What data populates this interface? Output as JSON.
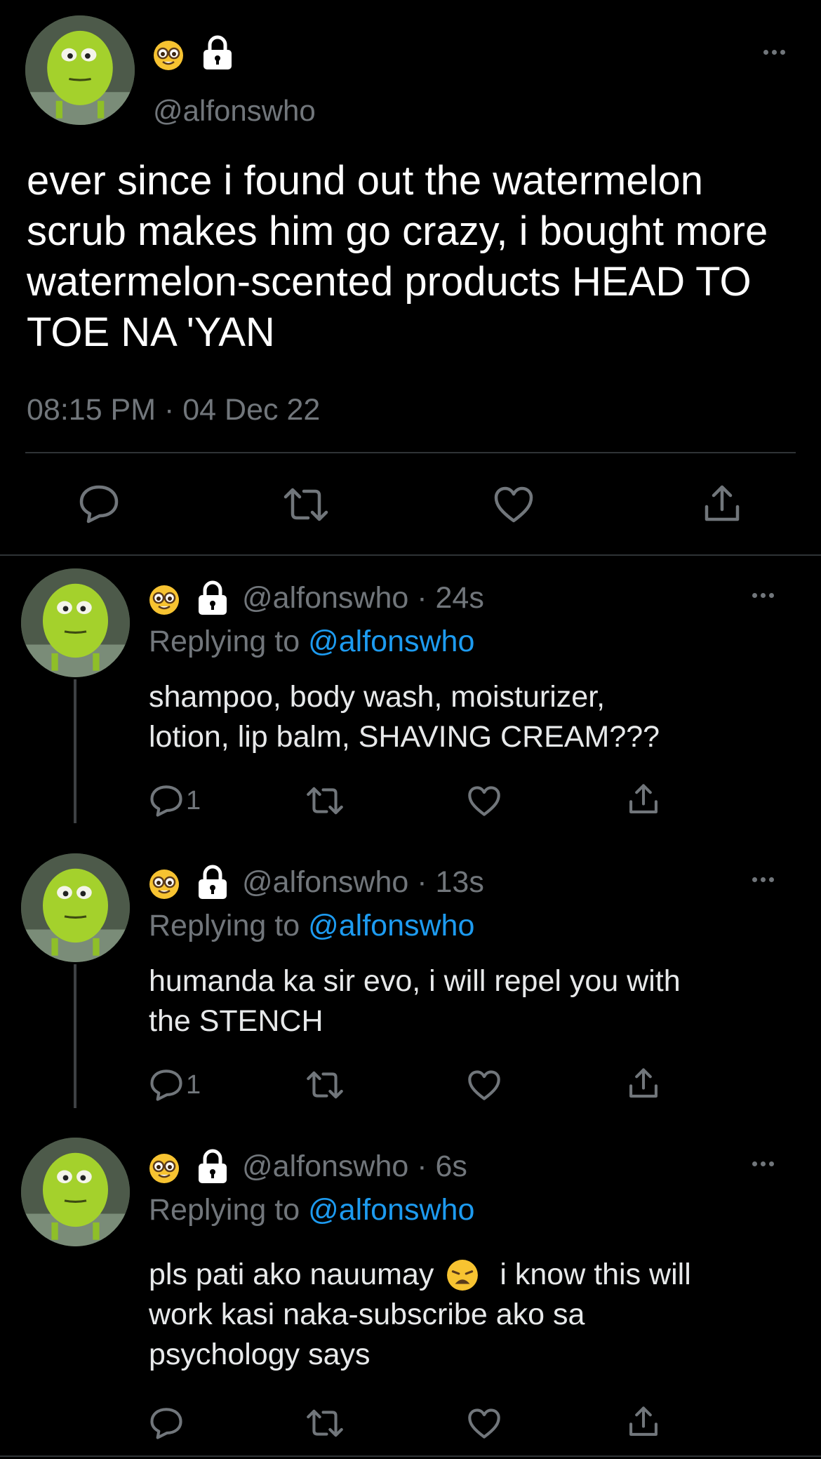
{
  "colors": {
    "background": "#000000",
    "text": "#e7e9ea",
    "muted": "#71767b",
    "link": "#1d9bf0",
    "divider": "#2f3336"
  },
  "main_tweet": {
    "avatar": "mike-wazowski-avatar",
    "badges": [
      "nerd-face-emoji",
      "lock-icon"
    ],
    "handle": "@alfonswho",
    "text": "ever since i found out the watermelon scrub makes him go crazy, i bought more watermelon-scented products HEAD TO TOE NA 'YAN",
    "timestamp": "08:15 PM · 04 Dec 22",
    "actions": [
      "reply-icon",
      "retweet-icon",
      "like-icon",
      "share-icon"
    ]
  },
  "replies": [
    {
      "handle": "@alfonswho",
      "time": "· 24s",
      "replying_prefix": "Replying to",
      "replying_handle": "@alfonswho",
      "text_lines": [
        "shampoo, body wash, moisturizer,",
        "lotion, lip balm, SHAVING CREAM???"
      ],
      "reply_count": "1"
    },
    {
      "handle": "@alfonswho",
      "time": "· 13s",
      "replying_prefix": "Replying to",
      "replying_handle": "@alfonswho",
      "text_lines": [
        "humanda ka sir evo, i will repel you with",
        "the STENCH"
      ],
      "reply_count": "1"
    },
    {
      "handle": "@alfonswho",
      "time": "· 6s",
      "replying_prefix": "Replying to",
      "replying_handle": "@alfonswho",
      "text_line1_before": "pls pati ako nauumay",
      "text_line1_after": "i know this will",
      "text_line1_emoji": "weary-face-emoji",
      "text_lines_rest": [
        "work kasi naka-subscribe ako sa",
        "psychology says"
      ],
      "reply_count": ""
    }
  ]
}
